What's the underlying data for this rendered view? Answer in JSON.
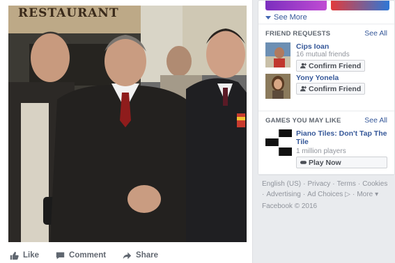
{
  "post": {
    "sign_text": "RESTAURANT",
    "actions": {
      "like": "Like",
      "comment": "Comment",
      "share": "Share"
    }
  },
  "sidebar": {
    "see_more": "See More",
    "friend_requests": {
      "title": "FRIEND REQUESTS",
      "see_all": "See All",
      "items": [
        {
          "name": "Cips Ioan",
          "mutual": "16 mutual friends",
          "button": "Confirm Friend"
        },
        {
          "name": "Yony Yonela",
          "mutual": "",
          "button": "Confirm Friend"
        }
      ]
    },
    "games": {
      "title": "GAMES YOU MAY LIKE",
      "see_all": "See All",
      "items": [
        {
          "title": "Piano Tiles: Don't Tap The Tile",
          "players": "1 million players",
          "button": "Play Now"
        }
      ]
    },
    "footer": {
      "links": [
        "English (US)",
        "Privacy",
        "Terms",
        "Cookies",
        "Advertising",
        "Ad Choices",
        "More"
      ],
      "copyright": "Facebook © 2016"
    }
  },
  "colors": {
    "link": "#365899",
    "muted": "#90949c",
    "background": "#e9ebee"
  }
}
